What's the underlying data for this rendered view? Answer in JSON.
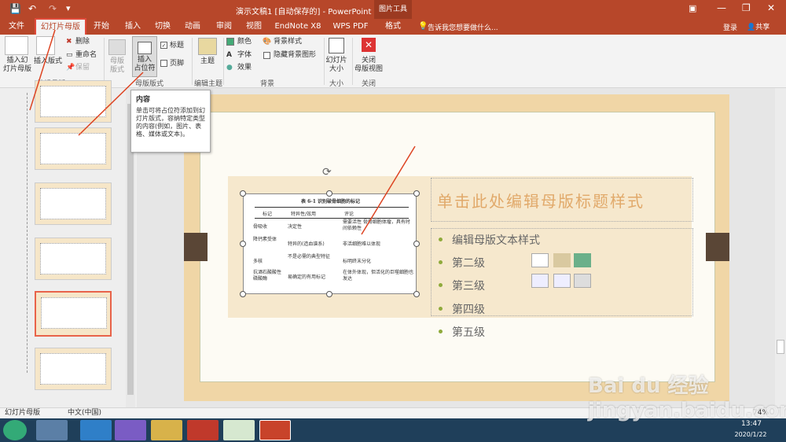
{
  "titlebar": {
    "title": "演示文稿1 [自动保存的] - PowerPoint",
    "picture_tools": "图片工具",
    "login": "登录",
    "share": "共享"
  },
  "tabs": [
    "文件",
    "幻灯片母版",
    "开始",
    "插入",
    "切换",
    "动画",
    "审阅",
    "视图",
    "EndNote X8",
    "WPS PDF",
    "格式"
  ],
  "tell_me": "告诉我您想要做什么...",
  "ribbon": {
    "insert_master": "插入幻\n灯片母版",
    "insert_layout": "插入版式",
    "delete": "删除",
    "rename": "重命名",
    "preserve": "保留",
    "master_layout": "母版\n版式",
    "insert_placeholder": "插入\n占位符",
    "title": "标题",
    "footer": "页脚",
    "themes": "主题",
    "colors": "颜色",
    "fonts": "字体",
    "effects": "效果",
    "bg_styles": "背景样式",
    "hide_bg": "隐藏背景图形",
    "slide_size": "幻灯片\n大小",
    "close_master": "关闭\n母版视图",
    "groups": {
      "edit_master": "编辑母版",
      "master_layout": "母版版式",
      "edit_theme": "编辑主题",
      "background": "背景",
      "size": "大小",
      "close": "关闭"
    }
  },
  "tooltip": {
    "title": "内容",
    "body": "单击可将占位符添加到幻灯片版式，容纳特定类型的内容(例如，图片、表格、媒体或文本)。"
  },
  "slide": {
    "title": "单击此处编辑母版标题样式",
    "levels": [
      "编辑母版文本样式",
      "第二级",
      "第三级",
      "第四级",
      "第五级"
    ],
    "table": {
      "caption": "表 6-1 识别破骨细胞的标记",
      "headers": [
        "标记",
        "特异性/效用",
        "评论"
      ],
      "rows": [
        [
          "骨吸收",
          "决定性",
          "需要活性 骨骨细胞体瘤，具有时间依赖性"
        ],
        [
          "降钙素受体",
          "特异的(造血谱系)",
          "非活细胞难以体现"
        ],
        [
          "多核",
          "不是必需的典型特征",
          "标明终末分化"
        ],
        [
          "抗酒石酸酸性磷酸酶",
          "易确定的有用标记",
          "在体外体现，但活化的巨噬细胞也发达"
        ]
      ]
    }
  },
  "status": {
    "view": "幻灯片母版",
    "lang": "中文(中国)",
    "zoom": "74%"
  },
  "taskbar": {
    "time": "13:47",
    "date": "2020/1/22"
  },
  "watermark": "Bai du 经验 jingyan.baidu.com",
  "colors": {
    "accent": "#b7472a",
    "green": "#8faa3b",
    "orange": "#e1a96a"
  }
}
